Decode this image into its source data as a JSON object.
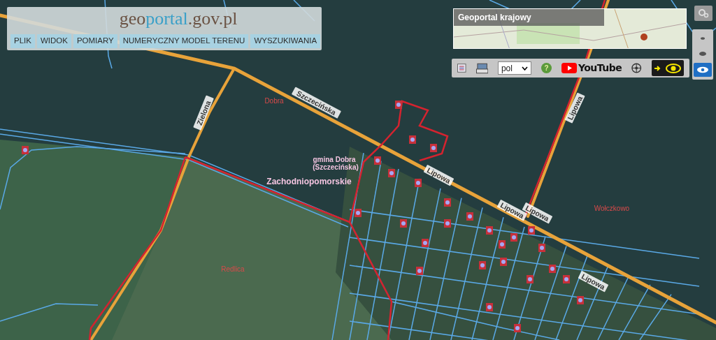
{
  "header": {
    "logo": [
      "geo",
      "portal",
      ".gov.pl"
    ],
    "menu": [
      "PLIK",
      "WIDOK",
      "POMIARY",
      "NUMERYCZNY MODEL TERENU",
      "WYSZUKIWANIA"
    ]
  },
  "overview_map": {
    "title": "Geoportal krajowy"
  },
  "toolbar": {
    "language": "pol",
    "help": "?",
    "video_label": "YouTube",
    "contrast_mode": false
  },
  "side_controls": [
    {
      "selected": false
    },
    {
      "selected": false
    },
    {
      "selected": true
    }
  ],
  "map_labels": [
    {
      "text": "Zielona",
      "kind": "street"
    },
    {
      "text": "Dobra",
      "kind": "place"
    },
    {
      "text": "Szczecińska",
      "kind": "street"
    },
    {
      "text": "gmina Dobra",
      "kind": "admin"
    },
    {
      "text": "(Szczecińska)",
      "kind": "admin"
    },
    {
      "text": "Zachodniopomorskie",
      "kind": "region"
    },
    {
      "text": "Lipowa",
      "kind": "street"
    },
    {
      "text": "Lipowa",
      "kind": "street"
    },
    {
      "text": "Lipowa",
      "kind": "street"
    },
    {
      "text": "Lipowa",
      "kind": "street"
    },
    {
      "text": "Lipowa",
      "kind": "street"
    },
    {
      "text": "Wołczkowo",
      "kind": "place"
    },
    {
      "text": "Redlica",
      "kind": "place"
    }
  ]
}
